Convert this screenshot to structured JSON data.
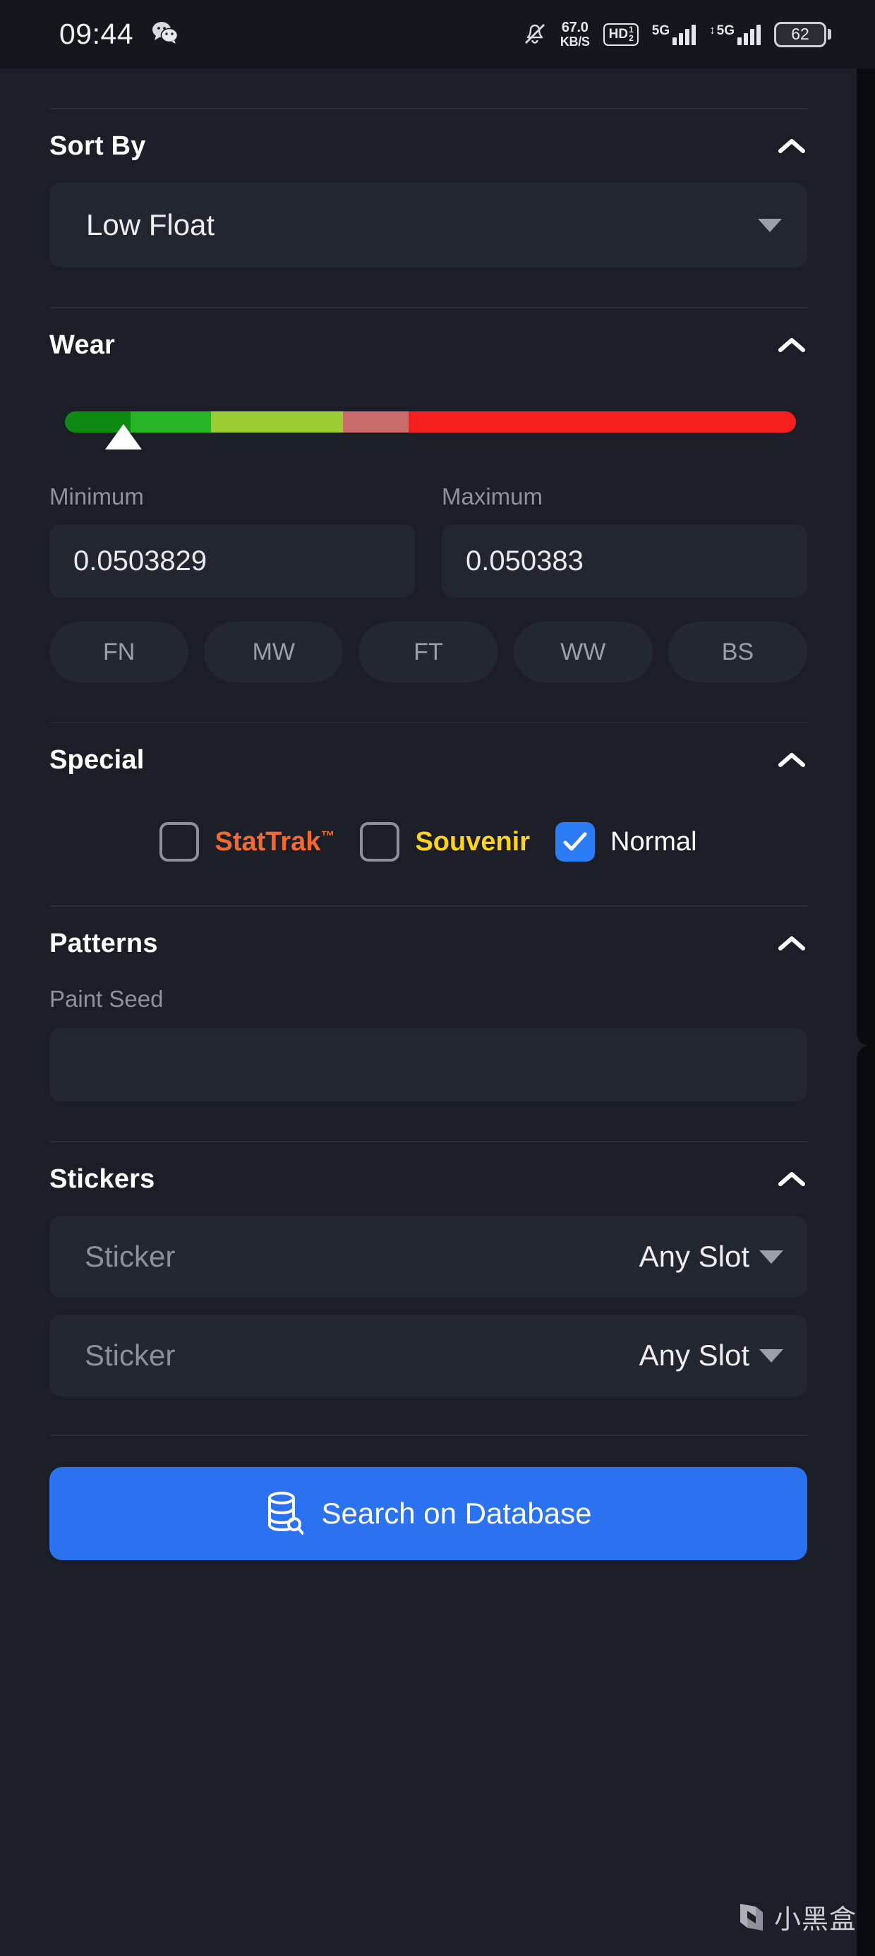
{
  "statusbar": {
    "clock": "09:44",
    "app_icon": "wechat-icon",
    "mute_icon": "bell-muted-icon",
    "net_speed_value": "67.0",
    "net_speed_unit": "KB/S",
    "hd_label": "HD",
    "hd_sub_top": "1",
    "hd_sub_bottom": "2",
    "sim1_label": "5G",
    "sim2_label": "5G",
    "sim2_prefix": "↕",
    "battery_level": "62"
  },
  "sections": {
    "sort_by": {
      "title": "Sort By",
      "collapse_icon": "chevron-up-icon",
      "selected": "Low Float",
      "dropdown_icon": "caret-down-icon"
    },
    "wear": {
      "title": "Wear",
      "collapse_icon": "chevron-up-icon",
      "slider": {
        "thumb_position_pct": 8,
        "segments": [
          {
            "name": "Factory New",
            "color": "#0d8a11",
            "width_pct": 9
          },
          {
            "name": "Minimal Wear",
            "color": "#25b524",
            "width_pct": 11
          },
          {
            "name": "Field-Tested",
            "color": "#9acd32",
            "width_pct": 18
          },
          {
            "name": "Well-Worn",
            "color": "#cb6c6c",
            "width_pct": 9
          },
          {
            "name": "Battle-Scarred",
            "color": "#f51f1f",
            "width_pct": 53
          }
        ]
      },
      "minimum_label": "Minimum",
      "minimum_value": "0.0503829",
      "maximum_label": "Maximum",
      "maximum_value": "0.050383",
      "chips": [
        {
          "label": "FN",
          "selected": false
        },
        {
          "label": "MW",
          "selected": false
        },
        {
          "label": "FT",
          "selected": false
        },
        {
          "label": "WW",
          "selected": false
        },
        {
          "label": "BS",
          "selected": false
        }
      ]
    },
    "special": {
      "title": "Special",
      "collapse_icon": "chevron-up-icon",
      "options": [
        {
          "label": "StatTrak",
          "suffix": "™",
          "checked": false,
          "color": "#f26a32"
        },
        {
          "label": "Souvenir",
          "suffix": "",
          "checked": false,
          "color": "#ffd21e"
        },
        {
          "label": "Normal",
          "suffix": "",
          "checked": true,
          "color": "#ffffff"
        }
      ],
      "checked_icon": "checkmark-icon"
    },
    "patterns": {
      "title": "Patterns",
      "collapse_icon": "chevron-up-icon",
      "paint_seed_label": "Paint Seed",
      "paint_seed_value": ""
    },
    "stickers": {
      "title": "Stickers",
      "collapse_icon": "chevron-up-icon",
      "rows": [
        {
          "placeholder": "Sticker",
          "slot": "Any Slot",
          "dropdown_icon": "caret-down-icon"
        },
        {
          "placeholder": "Sticker",
          "slot": "Any Slot",
          "dropdown_icon": "caret-down-icon"
        }
      ]
    }
  },
  "search_button": {
    "label": "Search on Database",
    "icon": "database-search-icon",
    "color": "#2b72f0"
  },
  "watermark": {
    "logo_icon": "xiaoheihe-logo-icon",
    "text": "小黑盒"
  }
}
